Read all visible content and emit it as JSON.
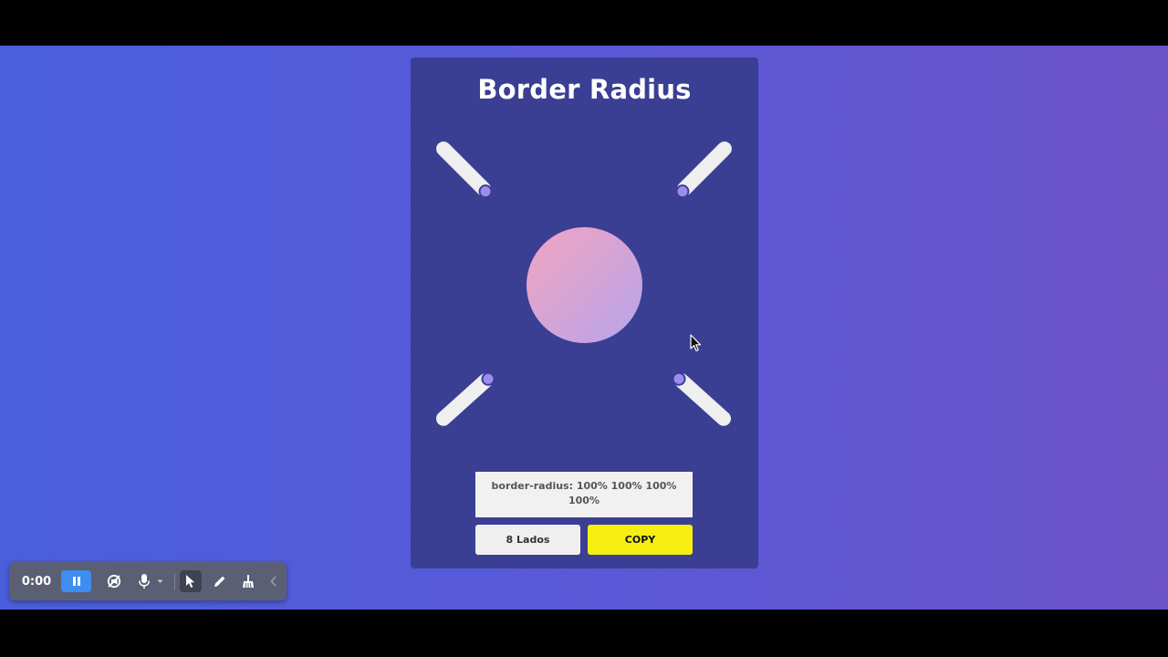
{
  "app": {
    "title": "Border Radius"
  },
  "sliders": [
    {
      "name": "top-left",
      "value": "100%"
    },
    {
      "name": "top-right",
      "value": "100%"
    },
    {
      "name": "bottom-left",
      "value": "100%"
    },
    {
      "name": "bottom-right",
      "value": "100%"
    }
  ],
  "preview": {
    "border_radius": "100% 100% 100% 100%",
    "gradient_start": "#f2a3c0",
    "gradient_end": "#b7a5ea"
  },
  "output": {
    "css_text": "border-radius: 100% 100% 100% 100%"
  },
  "buttons": {
    "sides_label": "8 Lados",
    "copy_label": "COPY"
  },
  "recorder": {
    "time": "0:00",
    "icons": [
      "pause-icon",
      "camera-off-icon",
      "microphone-icon",
      "chevron-down-icon",
      "pointer-icon",
      "pen-icon",
      "broom-icon",
      "chevron-left-icon"
    ]
  },
  "colors": {
    "card_bg": "#3a3f93",
    "copy_button": "#f5ee10",
    "slider_thumb": "#9d8cf0",
    "recorder_accent": "#3d8ef0"
  }
}
